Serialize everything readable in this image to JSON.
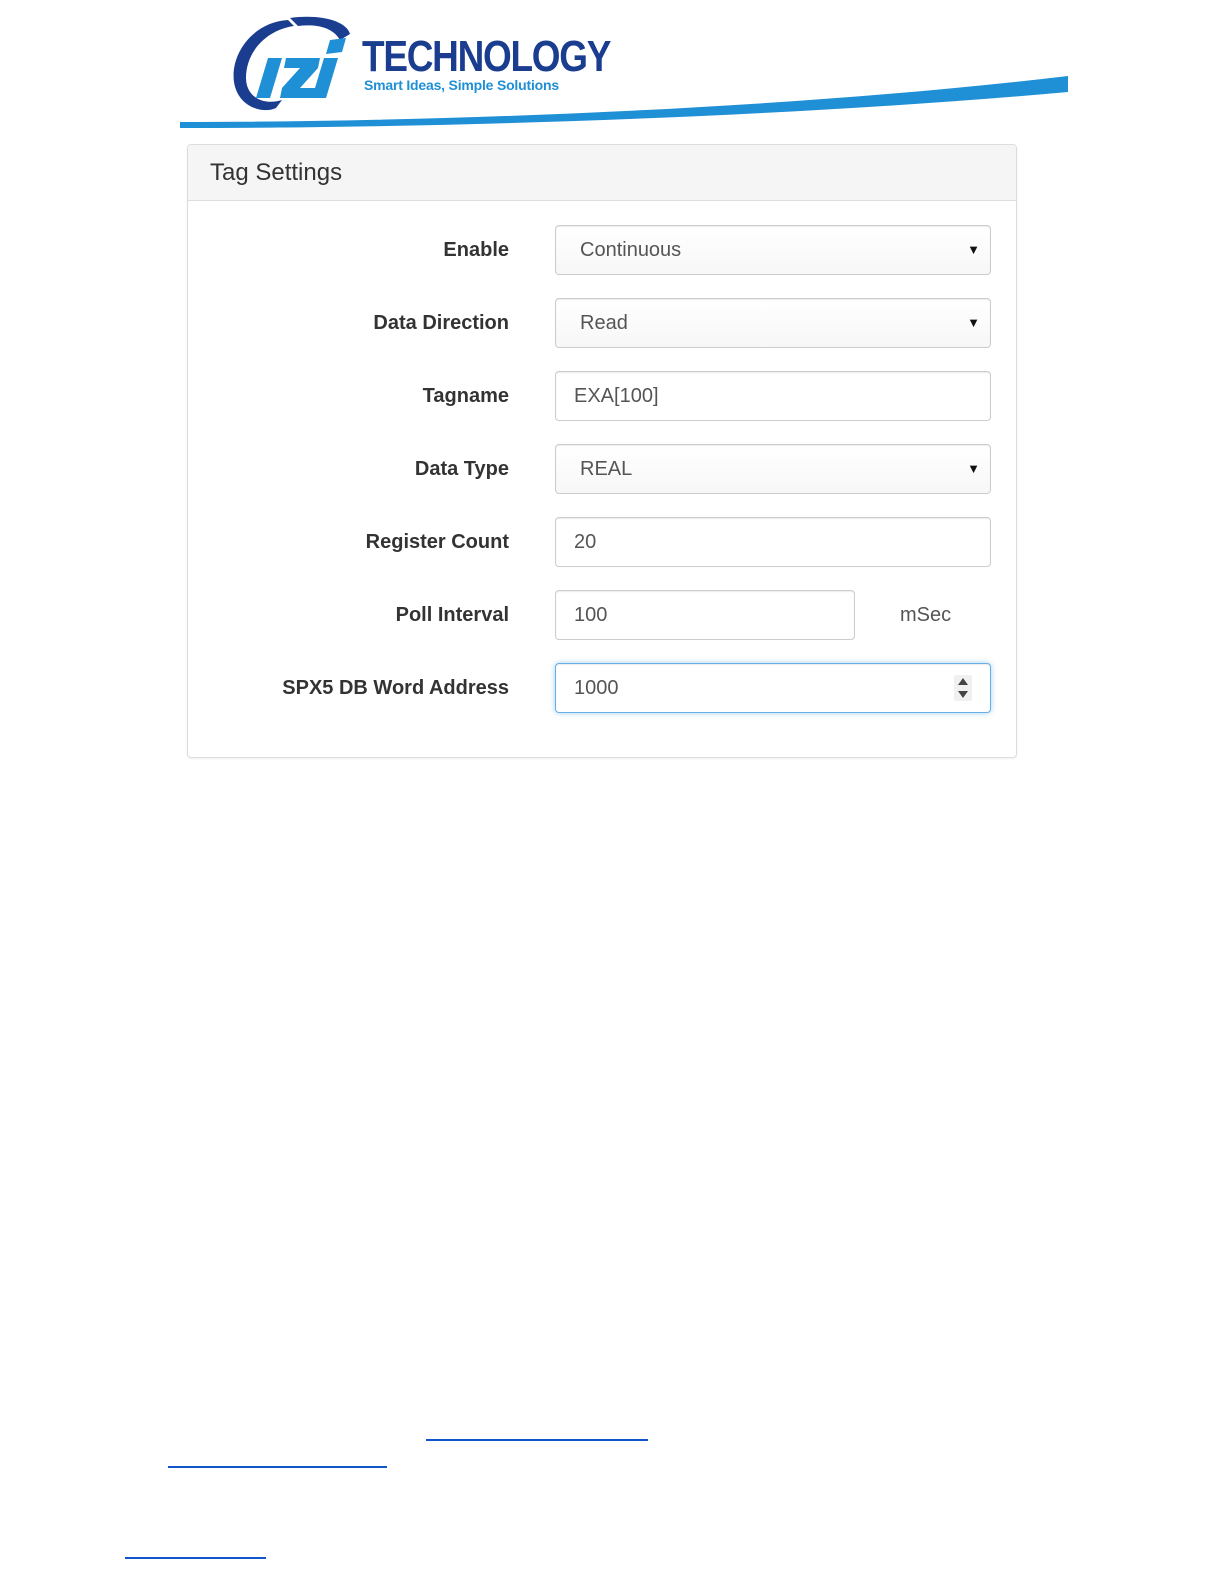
{
  "logo": {
    "title": "TECHNOLOGY",
    "tagline": "Smart Ideas, Simple Solutions",
    "brand_dark": "#1a3d8f",
    "brand_light": "#1f8fd6"
  },
  "panel": {
    "title": "Tag Settings"
  },
  "form": {
    "enable": {
      "label": "Enable",
      "value": "Continuous"
    },
    "data_direction": {
      "label": "Data Direction",
      "value": "Read"
    },
    "tagname": {
      "label": "Tagname",
      "value": "EXA[100]"
    },
    "data_type": {
      "label": "Data Type",
      "value": "REAL"
    },
    "register_count": {
      "label": "Register Count",
      "value": "20"
    },
    "poll_interval": {
      "label": "Poll Interval",
      "value": "100",
      "unit": "mSec"
    },
    "word_address": {
      "label": "SPX5 DB Word Address",
      "value": "1000"
    }
  },
  "icons": {
    "select_caret": "caret-down-icon",
    "number_spinner": "spinner-icon"
  }
}
